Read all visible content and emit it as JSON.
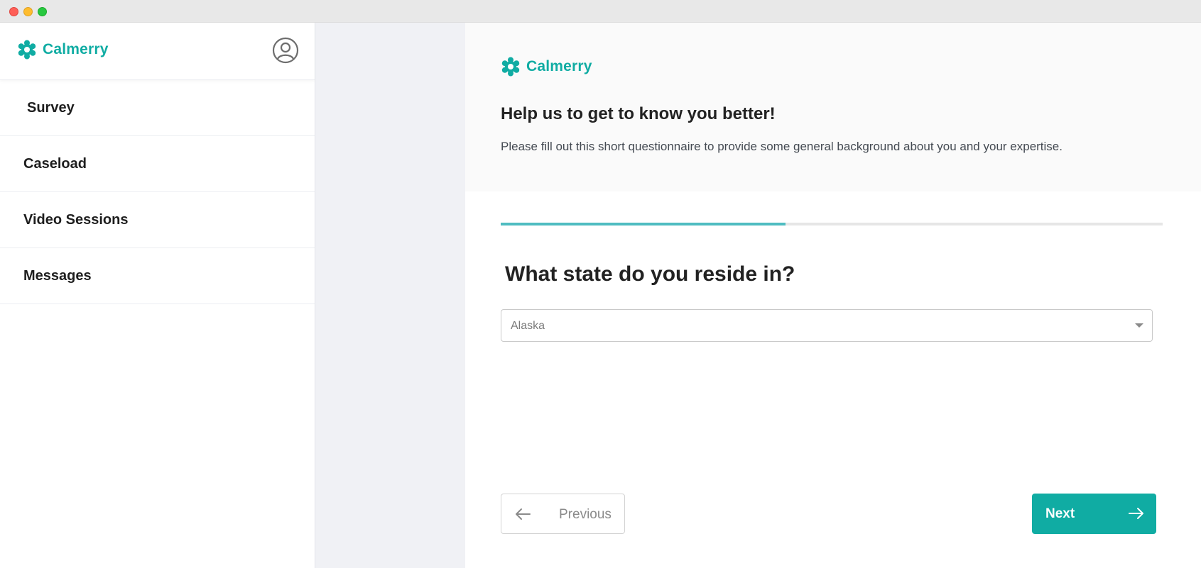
{
  "window": {
    "controls": [
      "close",
      "minimize",
      "maximize"
    ]
  },
  "brand": {
    "name": "Calmerry",
    "color": "#10aca3",
    "logo_icon": "flower-icon"
  },
  "sidebar": {
    "avatar_icon": "user-circle-icon",
    "items": [
      {
        "label": "Survey"
      },
      {
        "label": "Caseload"
      },
      {
        "label": "Video Sessions"
      },
      {
        "label": "Messages"
      }
    ]
  },
  "survey": {
    "heading": "Help us to get to know you better!",
    "subheading": "Please fill out this short questionnaire to provide some general background about you and your expertise.",
    "progress_fraction": 0.43,
    "progress_color": "#4fbcc1",
    "question": "What state do you reside in?",
    "state_select": {
      "value": "Alaska"
    },
    "buttons": {
      "previous": "Previous",
      "next": "Next"
    }
  }
}
